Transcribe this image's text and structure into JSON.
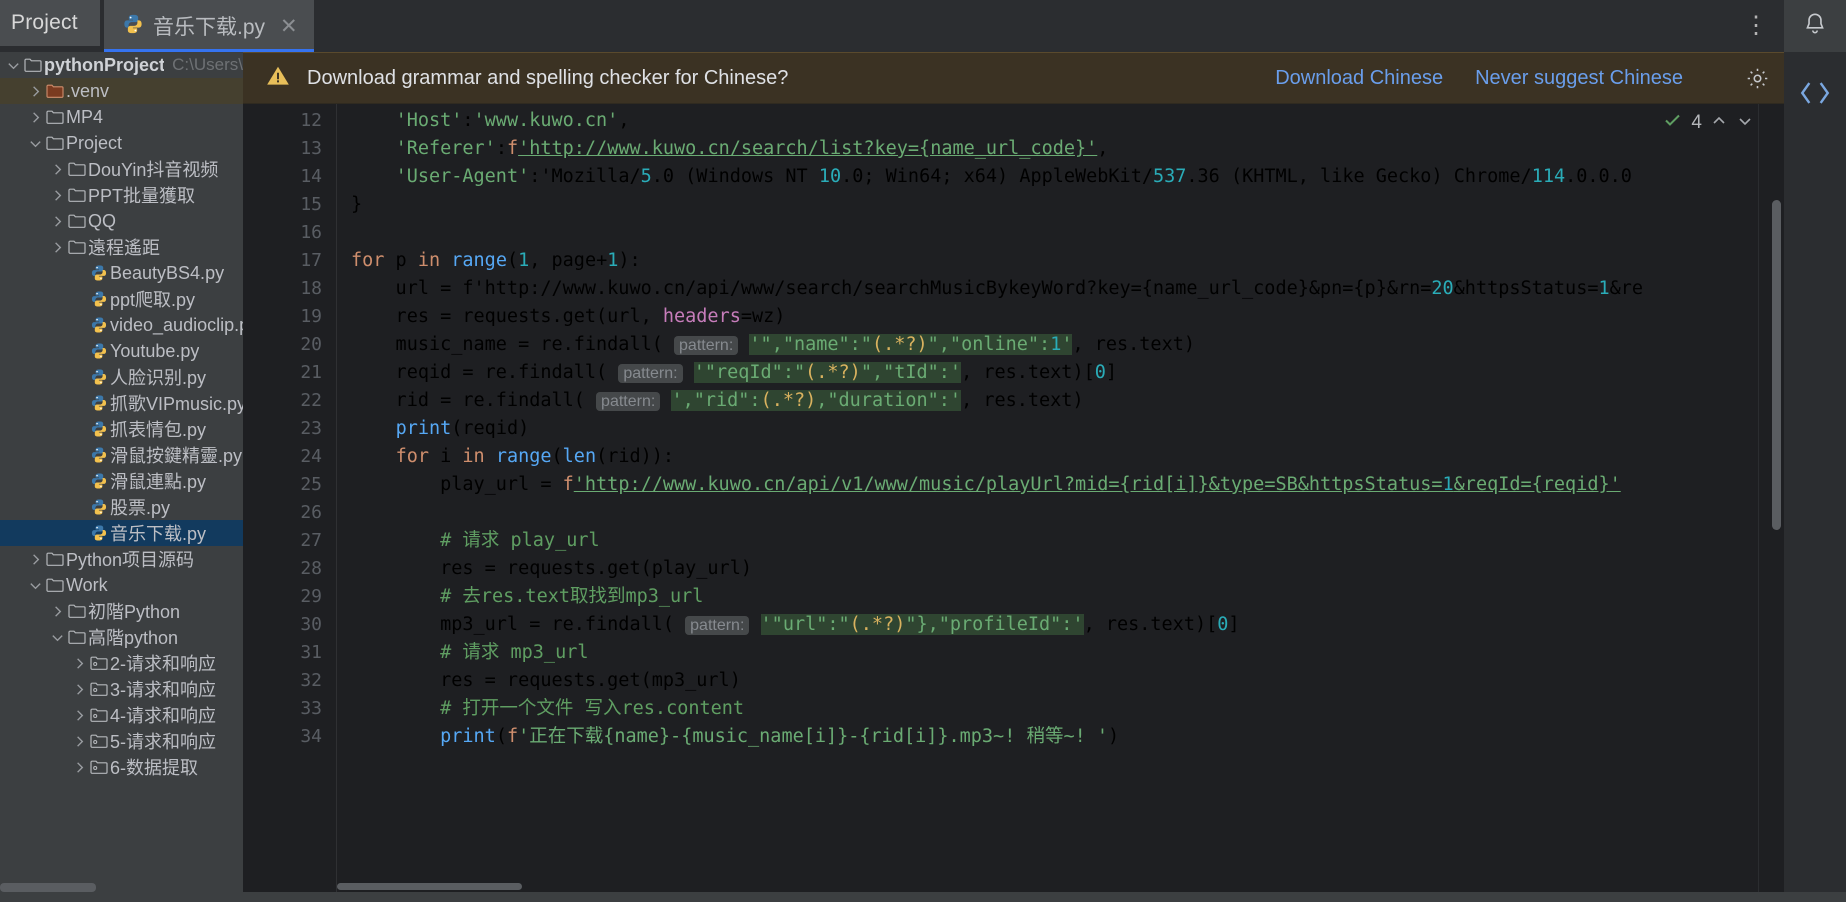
{
  "topbar": {
    "project_button": "Project",
    "tab": {
      "label": "音乐下载.py",
      "close": "✕",
      "icon": "python-file-icon"
    },
    "kebab": "⋮"
  },
  "sidebar": {
    "items": [
      {
        "label": "pythonProject",
        "path": "C:\\Users\\",
        "arrow": "down",
        "icon": "folder",
        "depth": 0,
        "bold": true,
        "state": "none"
      },
      {
        "label": ".venv",
        "path": "",
        "arrow": "right",
        "icon": "folder-venv",
        "depth": 1,
        "bold": false,
        "state": "venv"
      },
      {
        "label": "MP4",
        "path": "",
        "arrow": "right",
        "icon": "folder",
        "depth": 1,
        "bold": false,
        "state": "none"
      },
      {
        "label": "Project",
        "path": "",
        "arrow": "down",
        "icon": "folder",
        "depth": 1,
        "bold": false,
        "state": "none"
      },
      {
        "label": "DouYin抖音视频",
        "path": "",
        "arrow": "right",
        "icon": "folder",
        "depth": 2,
        "bold": false,
        "state": "none"
      },
      {
        "label": "PPT批量獲取",
        "path": "",
        "arrow": "right",
        "icon": "folder",
        "depth": 2,
        "bold": false,
        "state": "none"
      },
      {
        "label": "QQ",
        "path": "",
        "arrow": "right",
        "icon": "folder",
        "depth": 2,
        "bold": false,
        "state": "none"
      },
      {
        "label": "遠程遙距",
        "path": "",
        "arrow": "right",
        "icon": "folder",
        "depth": 2,
        "bold": false,
        "state": "none"
      },
      {
        "label": "BeautyBS4.py",
        "path": "",
        "arrow": "none",
        "icon": "python",
        "depth": 3,
        "bold": false,
        "state": "none"
      },
      {
        "label": "ppt爬取.py",
        "path": "",
        "arrow": "none",
        "icon": "python",
        "depth": 3,
        "bold": false,
        "state": "none"
      },
      {
        "label": "video_audioclip.py",
        "path": "",
        "arrow": "none",
        "icon": "python",
        "depth": 3,
        "bold": false,
        "state": "none"
      },
      {
        "label": "Youtube.py",
        "path": "",
        "arrow": "none",
        "icon": "python",
        "depth": 3,
        "bold": false,
        "state": "none"
      },
      {
        "label": "人脸识别.py",
        "path": "",
        "arrow": "none",
        "icon": "python",
        "depth": 3,
        "bold": false,
        "state": "none"
      },
      {
        "label": "抓歌VIPmusic.py",
        "path": "",
        "arrow": "none",
        "icon": "python",
        "depth": 3,
        "bold": false,
        "state": "none"
      },
      {
        "label": "抓表情包.py",
        "path": "",
        "arrow": "none",
        "icon": "python",
        "depth": 3,
        "bold": false,
        "state": "none"
      },
      {
        "label": "滑鼠按鍵精靈.py",
        "path": "",
        "arrow": "none",
        "icon": "python",
        "depth": 3,
        "bold": false,
        "state": "none"
      },
      {
        "label": "滑鼠連點.py",
        "path": "",
        "arrow": "none",
        "icon": "python",
        "depth": 3,
        "bold": false,
        "state": "none"
      },
      {
        "label": "股票.py",
        "path": "",
        "arrow": "none",
        "icon": "python",
        "depth": 3,
        "bold": false,
        "state": "none"
      },
      {
        "label": "音乐下载.py",
        "path": "",
        "arrow": "none",
        "icon": "python",
        "depth": 3,
        "bold": false,
        "state": "selected"
      },
      {
        "label": "Python项目源码",
        "path": "",
        "arrow": "right",
        "icon": "folder",
        "depth": 1,
        "bold": false,
        "state": "none"
      },
      {
        "label": "Work",
        "path": "",
        "arrow": "down",
        "icon": "folder",
        "depth": 1,
        "bold": false,
        "state": "none"
      },
      {
        "label": "初階Python",
        "path": "",
        "arrow": "right",
        "icon": "folder",
        "depth": 2,
        "bold": false,
        "state": "none"
      },
      {
        "label": "高階python",
        "path": "",
        "arrow": "down",
        "icon": "folder",
        "depth": 2,
        "bold": false,
        "state": "none"
      },
      {
        "label": "2-请求和响应",
        "path": "",
        "arrow": "right",
        "icon": "folder-module",
        "depth": 3,
        "bold": false,
        "state": "none"
      },
      {
        "label": "3-请求和响应",
        "path": "",
        "arrow": "right",
        "icon": "folder-module",
        "depth": 3,
        "bold": false,
        "state": "none"
      },
      {
        "label": "4-请求和响应",
        "path": "",
        "arrow": "right",
        "icon": "folder-module",
        "depth": 3,
        "bold": false,
        "state": "none"
      },
      {
        "label": "5-请求和响应",
        "path": "",
        "arrow": "right",
        "icon": "folder-module",
        "depth": 3,
        "bold": false,
        "state": "none"
      },
      {
        "label": "6-数据提取",
        "path": "",
        "arrow": "right",
        "icon": "folder-module",
        "depth": 3,
        "bold": false,
        "state": "none"
      }
    ]
  },
  "notification": {
    "icon": "warning-triangle-icon",
    "message": "Download grammar and spelling checker for Chinese?",
    "download_link": "Download Chinese",
    "never_link": "Never suggest Chinese",
    "gear": "gear-icon"
  },
  "editor": {
    "inspection_count": "4",
    "line_numbers": [
      "12",
      "13",
      "14",
      "15",
      "16",
      "17",
      "18",
      "19",
      "20",
      "21",
      "22",
      "23",
      "24",
      "25",
      "26",
      "27",
      "28",
      "29",
      "30",
      "31",
      "32",
      "33",
      "34"
    ],
    "code_lines": [
      "    'Host':'www.kuwo.cn',",
      "    'Referer':f'http://www.kuwo.cn/search/list?key={name_url_code}',",
      "    'User-Agent':'Mozilla/5.0 (Windows NT 10.0; Win64; x64) AppleWebKit/537.36 (KHTML, like Gecko) Chrome/114.0.0.0",
      "}",
      "",
      "for p in range(1, page+1):",
      "    url = f'http://www.kuwo.cn/api/www/search/searchMusicBykeyWord?key={name_url_code}&pn={p}&rn=20&httpsStatus=1&re",
      "    res = requests.get(url, headers=wz)",
      "    music_name = re.findall( pattern: '\",\"name\":\"(.*?)\",\"online\":1', res.text)",
      "    reqid = re.findall( pattern: '\"reqId\":\"(.*?)\",\"tId\":', res.text)[0]",
      "    rid = re.findall( pattern: ',\"rid\":(.*?),\"duration\":', res.text)",
      "    print(reqid)",
      "    for i in range(len(rid)):",
      "        play_url = f'http://www.kuwo.cn/api/v1/www/music/playUrl?mid={rid[i]}&type=SB&httpsStatus=1&reqId={reqid}'",
      "",
      "        # 请求 play_url",
      "        res = requests.get(play_url)",
      "        # 去res.text取找到mp3_url",
      "        mp3_url = re.findall( pattern: '\"url\":\"(.*?)\"},\"profileId\":', res.text)[0]",
      "        # 请求 mp3_url",
      "        res = requests.get(mp3_url)",
      "        # 打开一个文件 写入res.content",
      "        print(f'正在下载{name}-{music_name[i]}-{rid[i]}.mp3~! 稍等~! ')"
    ]
  },
  "colors": {
    "accent": "#3573f0",
    "link": "#6a9eeb",
    "notif_bg": "#3b3223",
    "editor_bg": "#1e1f22",
    "sidebar_bg": "#3c3f41",
    "selection": "#123a5e"
  }
}
